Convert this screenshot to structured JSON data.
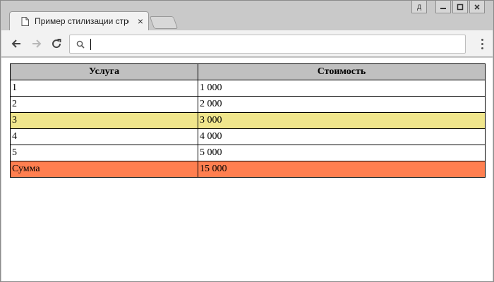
{
  "browser": {
    "tab_title": "Пример стилизации строк",
    "tab_close": "×",
    "address_value": "",
    "window_controls": {
      "user_label": "Д",
      "minimize": "—",
      "restore": "□",
      "close": "✕"
    }
  },
  "table": {
    "headers": [
      "Услуга",
      "Стоимость"
    ],
    "rows": [
      {
        "service": "1",
        "price": "1 000"
      },
      {
        "service": "2",
        "price": "2 000"
      },
      {
        "service": "3",
        "price": "3 000"
      },
      {
        "service": "4",
        "price": "4 000"
      },
      {
        "service": "5",
        "price": "5 000"
      }
    ],
    "total": {
      "label": "Сумма",
      "price": "15 000"
    }
  },
  "colors": {
    "header_bg": "#c0c0c0",
    "highlight_row_bg": "#f0e68c",
    "total_row_bg": "#ff7f50"
  }
}
